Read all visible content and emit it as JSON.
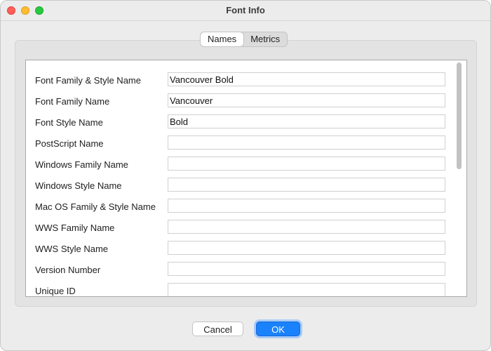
{
  "window": {
    "title": "Font Info",
    "controls": [
      "close-icon",
      "minimize-icon",
      "zoom-icon"
    ]
  },
  "tabs": [
    {
      "label": "Names",
      "active": true
    },
    {
      "label": "Metrics",
      "active": false
    }
  ],
  "fields": [
    {
      "label": "Font Family & Style Name",
      "value": "Vancouver Bold"
    },
    {
      "label": "Font Family Name",
      "value": "Vancouver"
    },
    {
      "label": "Font Style Name",
      "value": "Bold"
    },
    {
      "label": "PostScript Name",
      "value": ""
    },
    {
      "label": "Windows Family Name",
      "value": ""
    },
    {
      "label": "Windows Style Name",
      "value": ""
    },
    {
      "label": "Mac OS Family & Style Name",
      "value": ""
    },
    {
      "label": "WWS Family Name",
      "value": ""
    },
    {
      "label": "WWS Style Name",
      "value": ""
    },
    {
      "label": "Version Number",
      "value": ""
    },
    {
      "label": "Unique ID",
      "value": ""
    }
  ],
  "buttons": {
    "cancel_label": "Cancel",
    "ok_label": "OK"
  },
  "colors": {
    "accent": "#1a82fb",
    "close": "#ff5f57",
    "minimize": "#febc2e",
    "zoom": "#28c840"
  }
}
